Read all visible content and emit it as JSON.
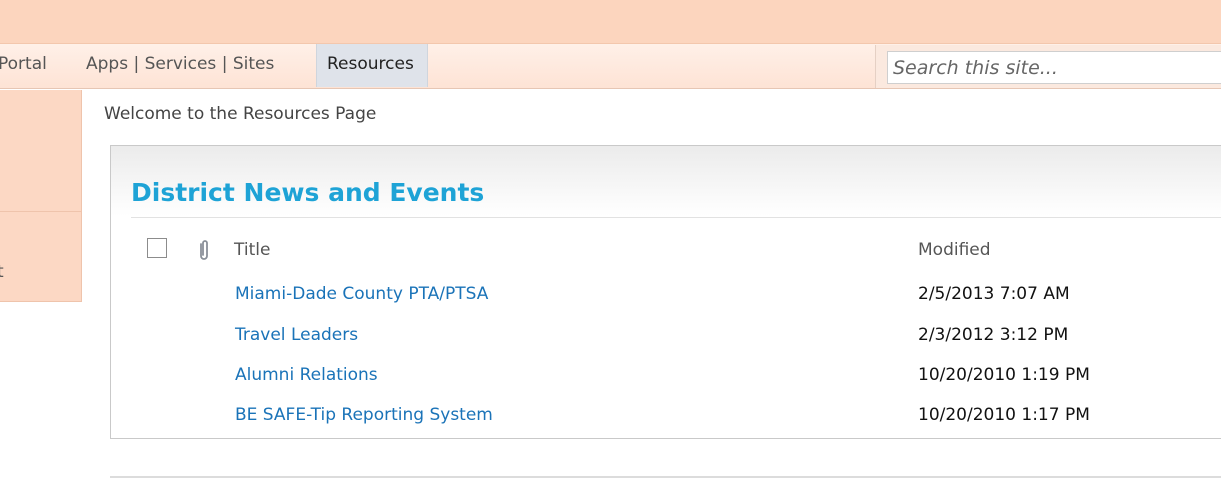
{
  "nav": {
    "portal": "Portal",
    "apps": "Apps | Services | Sites",
    "resources": "Resources"
  },
  "search": {
    "placeholder": "Search this site..."
  },
  "sidebar": {
    "partial_glyph": "t"
  },
  "welcome": "Welcome to the Resources Page",
  "webpart": {
    "title": "District News and Events",
    "columns": {
      "title": "Title",
      "modified": "Modified"
    },
    "rows": [
      {
        "title": "Miami-Dade County PTA/PTSA",
        "modified": "2/5/2013 7:07 AM"
      },
      {
        "title": "Travel Leaders",
        "modified": "2/3/2012 3:12 PM"
      },
      {
        "title": "Alumni Relations",
        "modified": "10/20/2010 1:19 PM"
      },
      {
        "title": "BE SAFE-Tip Reporting System",
        "modified": "10/20/2010 1:17 PM"
      }
    ]
  },
  "icons": {
    "attachment": "paperclip-icon",
    "select_all": "checkbox"
  },
  "colors": {
    "top_bar": "#fcd5be",
    "title": "#1ea3d6",
    "link": "#1a73b8"
  }
}
